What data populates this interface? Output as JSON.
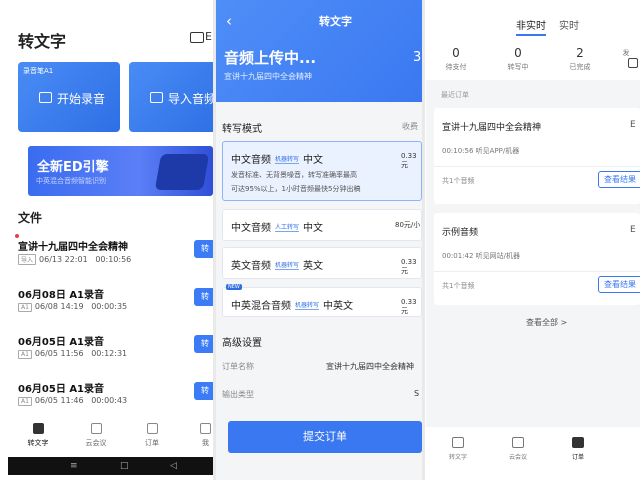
{
  "screen1": {
    "title": "转文字",
    "header_right": "E",
    "card1": {
      "tag": "录音笔A1",
      "label": "开始录音"
    },
    "card2": {
      "label": "导入音频"
    },
    "banner": {
      "title": "全新ED引擎",
      "subtitle": "中英混合音频智能识别"
    },
    "files_title": "文件",
    "files": [
      {
        "name": "宣讲十九届四中全会精神",
        "badge": "导入",
        "date": "06/13  22:01",
        "duration": "00:10:56",
        "button": "转文"
      },
      {
        "name": "06月08日 A1录音",
        "badge": "A1",
        "date": "06/08  14:19",
        "duration": "00:00:35",
        "button": "转文"
      },
      {
        "name": "06月05日 A1录音",
        "badge": "A1",
        "date": "06/05  11:56",
        "duration": "00:12:31",
        "button": "转文"
      },
      {
        "name": "06月05日 A1录音",
        "badge": "A1",
        "date": "06/05  11:46",
        "duration": "00:00:43",
        "button": "转文"
      }
    ],
    "tabs": [
      "转文字",
      "云会议",
      "订单",
      "我"
    ],
    "system_nav": [
      "≡",
      "□",
      "◁"
    ]
  },
  "screen2": {
    "back": "‹",
    "title": "转文字",
    "status": "音频上传中...",
    "count": "3",
    "file_name": "宣讲十九届四中全会精神",
    "mode_label": "转写模式",
    "mode_right": "收费",
    "options": [
      {
        "name": "中文音频",
        "tag": "机器转写",
        "lang": "中文",
        "price": "0.33元",
        "desc1": "发音标准、无背景噪音，转写准确率最高",
        "desc2": "可达95%以上，1小时音频最快5分钟出稿",
        "new": ""
      },
      {
        "name": "中文音频",
        "tag": "人工转写",
        "lang": "中文",
        "price": "80元/小",
        "desc1": "",
        "desc2": "",
        "new": ""
      },
      {
        "name": "英文音频",
        "tag": "机器转写",
        "lang": "英文",
        "price": "0.33元",
        "desc1": "",
        "desc2": "",
        "new": ""
      },
      {
        "name": "中英混合音频",
        "tag": "机器转写",
        "lang": "中英文",
        "price": "0.33元",
        "desc1": "",
        "desc2": "",
        "new": "NEW"
      }
    ],
    "advanced_label": "高级设置",
    "order_name_label": "订单名称",
    "order_name_value": "宣讲十九届四中全会精神",
    "output_label": "输出类型",
    "output_value": "S",
    "submit": "提交订单"
  },
  "screen3": {
    "segments": [
      "非实时",
      "实时"
    ],
    "stats": [
      {
        "value": "0",
        "label": "待支付"
      },
      {
        "value": "0",
        "label": "转写中"
      },
      {
        "value": "2",
        "label": "已完成"
      },
      {
        "value": "",
        "label": "发"
      }
    ],
    "recent_label": "最近订单",
    "orders": [
      {
        "title": "宣讲十九届四中全会精神",
        "edge": "E",
        "meta": "00:10:56    听见APP/机器",
        "count": "共1个音频",
        "button": "查看结果"
      },
      {
        "title": "示例音频",
        "edge": "E",
        "meta": "00:01:42    听见网站/机器",
        "count": "共1个音频",
        "button": "查看结果"
      }
    ],
    "view_all": "查看全部 >",
    "tabs": [
      "转文字",
      "云会议",
      "订单"
    ]
  },
  "colors": {
    "accent": "#3a78f2",
    "new_dot": "#e84040"
  }
}
